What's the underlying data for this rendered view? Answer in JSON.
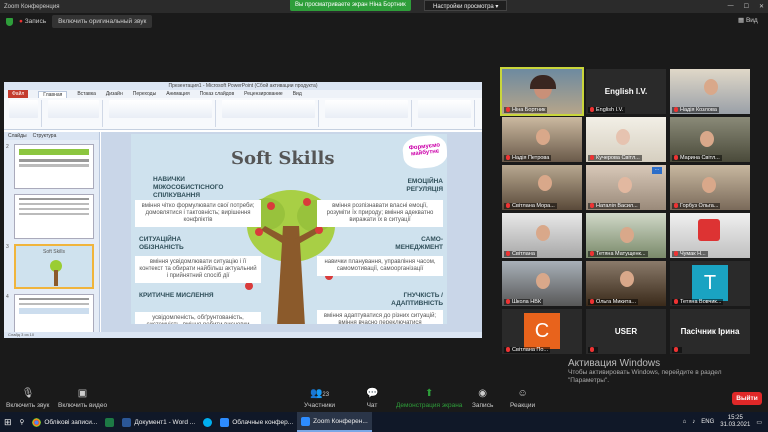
{
  "window": {
    "title": "Zoom Конференция"
  },
  "banner": {
    "viewing": "Вы просматриваете экран Ніна Бортник",
    "view_settings": "Настройки просмотра"
  },
  "subbar": {
    "recording_label": "Запись",
    "original_sound": "Включить оригинальный звук",
    "view": "Вид"
  },
  "powerpoint": {
    "title": "Презентация1 - Microsoft PowerPoint (Сбой активации продукта)",
    "tabs": [
      "Файл",
      "Главная",
      "Вставка",
      "Дизайн",
      "Переходы",
      "Анимация",
      "Показ слайдов",
      "Рецензирование",
      "Вид"
    ],
    "active_tab": "Главная",
    "left_tabs": [
      "Слайды",
      "Структура"
    ],
    "slide_numbers": [
      "2",
      "3",
      "4"
    ],
    "thumb_texts": [
      "Soft Skills"
    ],
    "status": "Слайд 3 из 10"
  },
  "slide": {
    "logo": "Формуємо майбутнє",
    "title": "Soft Skills",
    "label_interpersonal": "НАВИЧКИ МІЖОСОБИСТІСНОГО СПІЛКУВАННЯ",
    "text_interpersonal": "вміння чітко формулювати свої потреби; домовлятися і тактовність; вирішення конфліктів",
    "label_emotional": "ЕМОЦІЙНА РЕГУЛЯЦІЯ",
    "text_emotional": "вміння розпізнавати власні емоції, розуміти їх природу; вміння адекватно виражати їх в ситуації",
    "label_situational": "СИТУАЦІЙНА ОБІЗНАНІСТЬ",
    "text_situational": "вміння усвідомлювати ситуацію і її контекст та обирати найбільш актуальний і прийнятний спосіб дії",
    "label_self": "САМО-МЕНЕДЖМЕНТ",
    "text_self": "навички планування, управління часом, самомотивації, самоорганізації",
    "label_critical": "КРИТИЧНЕ МИСЛЕННЯ",
    "text_critical": "усвідомленість, обґрунтованість, системність, вміння робити висновки",
    "label_flex": "ГНУЧКІСТЬ / АДАПТИВНІСТЬ",
    "text_flex": "вміння адаптуватися до різних ситуацій; вміння вчасно переключатися"
  },
  "participants": [
    {
      "name": "Ніна Бортник",
      "type": "video",
      "speaking": true
    },
    {
      "name": "English I.V.",
      "type": "name"
    },
    {
      "name": "Надія Козлова",
      "type": "video"
    },
    {
      "name": "Надія Петрова",
      "type": "video"
    },
    {
      "name": "Кучерова Світл...",
      "type": "video"
    },
    {
      "name": "Марина Світл...",
      "type": "video"
    },
    {
      "name": "Світлана Мора...",
      "type": "video"
    },
    {
      "name": "Наталія Васил...",
      "type": "video"
    },
    {
      "name": "Горбуз Ольга...",
      "type": "video"
    },
    {
      "name": "Світлана",
      "type": "video"
    },
    {
      "name": "Тетяна Матущенк...",
      "type": "video"
    },
    {
      "name": "Чумак Н...",
      "type": "video"
    },
    {
      "name": "Школа НВК",
      "type": "video"
    },
    {
      "name": "Ольга Микита...",
      "type": "video"
    },
    {
      "name": "Тетяна Вовчик...",
      "type": "avatar",
      "letter": "T",
      "color": "#1aa3c2"
    },
    {
      "name": "Світлана По...",
      "type": "avatar",
      "letter": "C",
      "color": "#e8631c"
    },
    {
      "name": "USER",
      "type": "name"
    },
    {
      "name": "Пасічник Ірина",
      "type": "name"
    }
  ],
  "activation": {
    "heading": "Активация Windows",
    "text": "Чтобы активировать Windows, перейдите в раздел \"Параметры\"."
  },
  "toolbar": {
    "unmute": "Включить звук",
    "start_video": "Включить видео",
    "participants_count": "23",
    "participants": "Участники",
    "chat": "Чат",
    "share_screen": "Демонстрация экрана",
    "record": "Запись",
    "reactions": "Реакции",
    "end": "Выйти"
  },
  "taskbar": {
    "items": [
      "Облікові записи...",
      "Документ1 - Word ...",
      "",
      "Облачные конфер...",
      "Zoom Конферен..."
    ],
    "lang": "ENG",
    "time": "15:25",
    "date": "31.03.2021"
  },
  "colors": {
    "share_green": "#2e9e3a",
    "end_red": "#e02828",
    "speaker_outline": "#c9d63b"
  }
}
